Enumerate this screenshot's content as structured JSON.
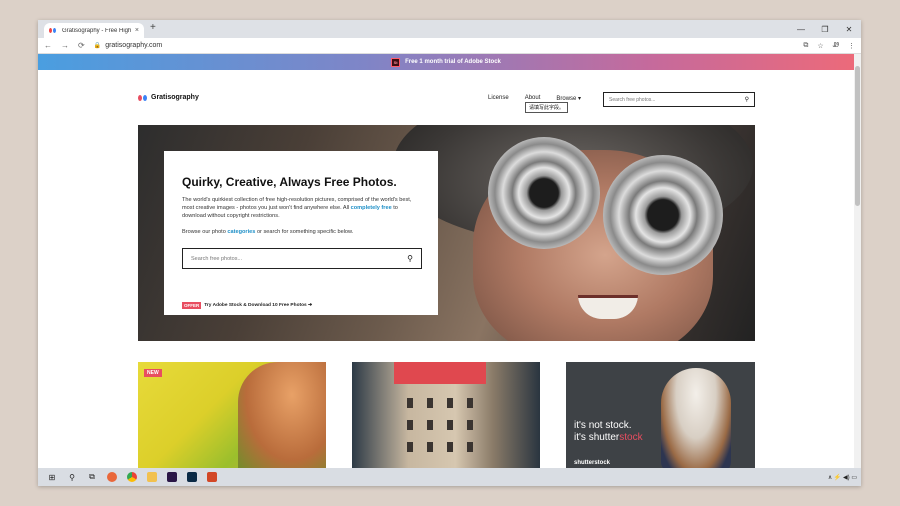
{
  "browser": {
    "tab_title": "Gratisography - Free High-Res",
    "tab_close": "×",
    "new_tab": "+",
    "url": "gratisography.com",
    "nav": {
      "back": "←",
      "forward": "→",
      "reload": "⟳",
      "lock": "🔒"
    },
    "controls": {
      "minimize": "—",
      "maximize": "❐",
      "close": "✕"
    },
    "right_icons": {
      "translate": "⧉",
      "star": "☆",
      "ext": "Ꮺ",
      "menu": "⋮"
    }
  },
  "promo": {
    "icon": "St",
    "text": "Free 1 month trial of Adobe Stock"
  },
  "site": {
    "logo": "Gratisography",
    "menu": [
      "License",
      "About",
      "Browse ▾"
    ],
    "header_search_placeholder": "Search free photos...",
    "tooltip": "请填写此字段。"
  },
  "hero": {
    "title": "Quirky, Creative, Always Free Photos.",
    "desc_a": "The world's quirkiest collection of free high-resolution pictures, comprised of the world's best, most creative images - photos you just won't find anywhere else. All ",
    "desc_link": "completely free",
    "desc_b": " to download without copyright restrictions.",
    "browse_a": "Browse our photo ",
    "browse_link": "categories",
    "browse_b": " or search for something specific below.",
    "search_placeholder": "Search free photos...",
    "offer_badge": "OFFER",
    "offer_text": "Try Adobe Stock & Download 10 Free Photos ➔"
  },
  "thumbs": {
    "new_badge": "NEW",
    "ad_line1": "it's not stock.",
    "ad_line2_a": "it's shutter",
    "ad_line2_b": "stock",
    "ad_brand": "shutterstock"
  },
  "taskbar": {
    "start": "⊞",
    "search": "⚲",
    "taskview": "⧉",
    "tray": "∧ ⚡ ◀) ▭"
  }
}
